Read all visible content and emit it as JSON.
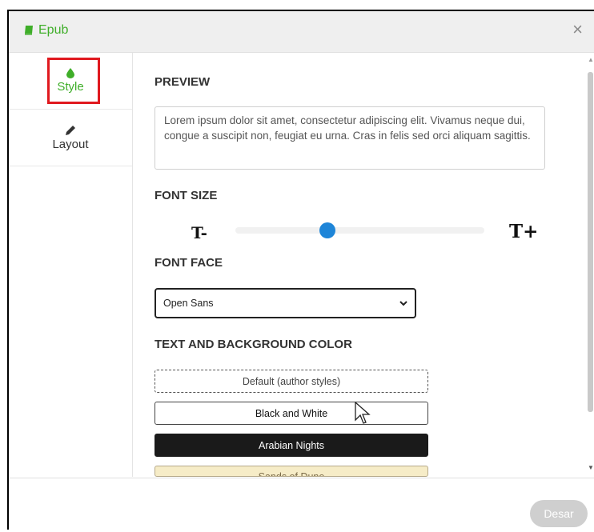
{
  "dialog": {
    "title": "Epub",
    "title_icon": "book-icon",
    "close_symbol": "×"
  },
  "sidenav": {
    "items": [
      {
        "label": "Style",
        "icon": "droplet-icon",
        "active": true
      },
      {
        "label": "Layout",
        "icon": "pencil-icon",
        "active": false
      }
    ]
  },
  "content": {
    "preview_heading": "PREVIEW",
    "preview_text": "Lorem ipsum dolor sit amet, consectetur adipiscing elit. Vivamus neque dui, congue a suscipit non, feugiat eu urna. Cras in felis sed orci aliquam sagittis.",
    "font_size_heading": "FONT SIZE",
    "font_size_decrease": "T-",
    "font_size_increase": "T+",
    "font_size_level": 0.35,
    "font_face_heading": "FONT FACE",
    "font_face_selected": "Open Sans",
    "color_heading": "TEXT AND BACKGROUND COLOR",
    "color_options": [
      "Default (author styles)",
      "Black and White",
      "Arabian Nights",
      "Sands of Dune"
    ]
  },
  "footer": {
    "close_label": "Desar"
  },
  "colors": {
    "accent": "#3fae29",
    "highlight_box": "#e0191f",
    "slider_thumb": "#1e85d8",
    "night_bg": "#1a1a1a",
    "sands_bg": "#f6ecc7"
  }
}
